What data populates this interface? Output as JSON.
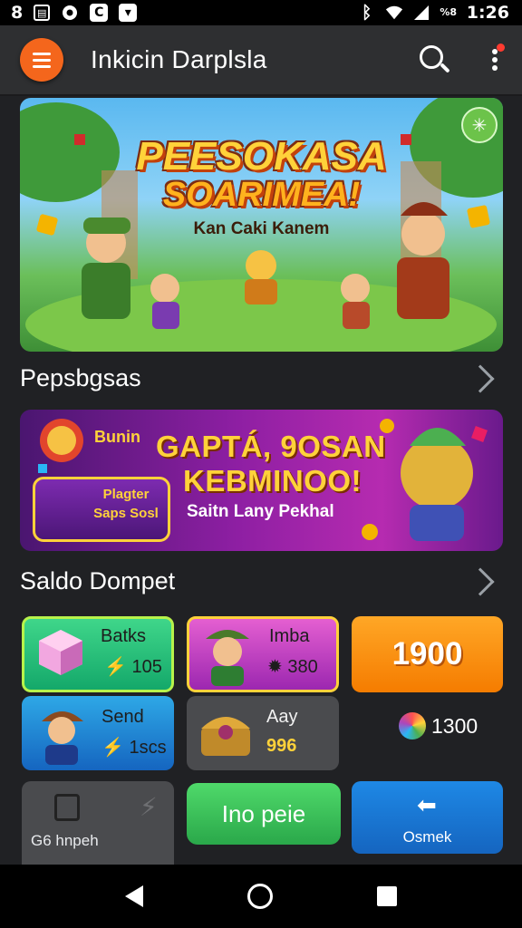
{
  "status_bar": {
    "left_text": "8",
    "time": "1:26",
    "battery_percent": "%8",
    "icons": [
      "sim-icon",
      "shield-icon",
      "app-icon",
      "download-icon",
      "bluetooth-icon",
      "wifi-icon",
      "signal-icon"
    ]
  },
  "app_bar": {
    "title": "Inkicin Darplsla",
    "accent_color": "#f4661c"
  },
  "hero": {
    "title_line1": "PEESOKASA",
    "title_line2": "SOARIMEA!",
    "subtitle": "Kan Caki Kanem",
    "badge_icon": "sparkle-icon"
  },
  "section1": {
    "title": "Pepsbgsas"
  },
  "promo": {
    "name": "Bunin",
    "headline1": "GAPTÁ, 9OSAN",
    "headline2": "KEBMINOO!",
    "subline": "Saitn Lany Pekhal",
    "card_line1": "Plagter",
    "card_line2": "Saps Sosl"
  },
  "section2": {
    "title": "Saldo Dompet"
  },
  "tiles": {
    "blocks": {
      "label": "Batks",
      "value": "105"
    },
    "hero": {
      "label": "Imba",
      "value": "380"
    },
    "coins": {
      "value": "1900"
    },
    "send": {
      "label": "Send",
      "value": "1scs"
    },
    "pay": {
      "label": "Aay",
      "value": "996"
    },
    "gems": {
      "value": "1300"
    }
  },
  "actions": {
    "lock_label": "G6 hnpeh",
    "green_label": "Ino peie",
    "blue_label": "Osmek"
  }
}
